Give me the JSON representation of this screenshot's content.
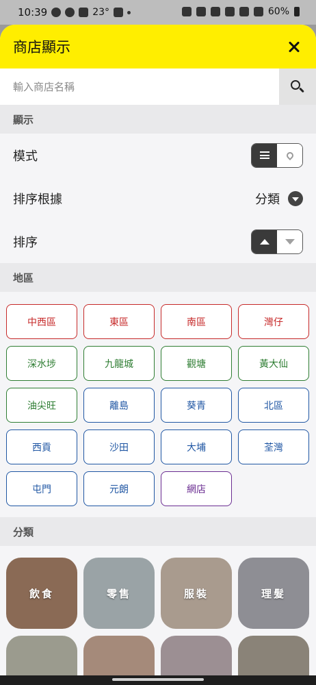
{
  "status_bar": {
    "time": "10:39",
    "temperature": "23°",
    "battery": "60%"
  },
  "header": {
    "title": "商店顯示"
  },
  "search": {
    "placeholder": "輸入商店名稱"
  },
  "display": {
    "section_title": "顯示",
    "mode_label": "模式",
    "sort_by_label": "排序根據",
    "sort_by_value": "分類",
    "order_label": "排序"
  },
  "region": {
    "section_title": "地區",
    "districts": [
      {
        "label": "中西區",
        "color": "#c62828"
      },
      {
        "label": "東區",
        "color": "#c62828"
      },
      {
        "label": "南區",
        "color": "#c62828"
      },
      {
        "label": "灣仔",
        "color": "#c62828"
      },
      {
        "label": "深水埗",
        "color": "#2e7d32"
      },
      {
        "label": "九龍城",
        "color": "#2e7d32"
      },
      {
        "label": "觀塘",
        "color": "#2e7d32"
      },
      {
        "label": "黃大仙",
        "color": "#2e7d32"
      },
      {
        "label": "油尖旺",
        "color": "#2e7d32"
      },
      {
        "label": "離島",
        "color": "#1f56a3"
      },
      {
        "label": "葵青",
        "color": "#1f56a3"
      },
      {
        "label": "北區",
        "color": "#1f56a3"
      },
      {
        "label": "西貢",
        "color": "#1f56a3"
      },
      {
        "label": "沙田",
        "color": "#1f56a3"
      },
      {
        "label": "大埔",
        "color": "#1f56a3"
      },
      {
        "label": "荃灣",
        "color": "#1f56a3"
      },
      {
        "label": "屯門",
        "color": "#1f56a3"
      },
      {
        "label": "元朗",
        "color": "#1f56a3"
      },
      {
        "label": "網店",
        "color": "#6a2c91"
      }
    ]
  },
  "category": {
    "section_title": "分類",
    "items": [
      {
        "label": "飲食",
        "color": "#8a6a55"
      },
      {
        "label": "零售",
        "color": "#9aa3a6"
      },
      {
        "label": "服裝",
        "color": "#a99b8e"
      },
      {
        "label": "理髮",
        "color": "#8e8e94"
      },
      {
        "label": "",
        "color": "#9b9b8e"
      },
      {
        "label": "",
        "color": "#a58a7a"
      },
      {
        "label": "",
        "color": "#9c8f93"
      },
      {
        "label": "",
        "color": "#8a8378"
      }
    ]
  },
  "colors": {
    "accent": "#ffee00",
    "section_bg": "#e9e9eb",
    "sheet_bg": "#f5f5f7"
  }
}
